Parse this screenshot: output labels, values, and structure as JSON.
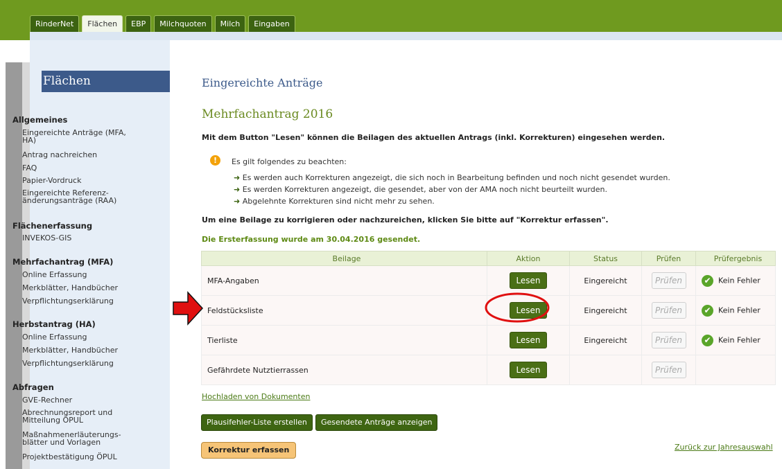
{
  "tabs": [
    "RinderNet",
    "Flächen",
    "EBP",
    "Milchquoten",
    "Milch",
    "Eingaben"
  ],
  "active_tab": "Flächen",
  "sidebar": {
    "title": "Flächen",
    "sections": [
      {
        "heading": "Allgemeines",
        "items": [
          "Eingereichte Anträge (MFA,\nHA)",
          "Antrag nachreichen",
          "FAQ",
          "Papier-Vordruck",
          "Eingereichte Referenz-\nänderungsanträge (RAA)"
        ]
      },
      {
        "heading": "Flächenerfassung",
        "items": [
          "INVEKOS-GIS"
        ]
      },
      {
        "heading": "Mehrfachantrag (MFA)",
        "items": [
          "Online Erfassung",
          "Merkblätter, Handbücher",
          "Verpflichtungserklärung"
        ]
      },
      {
        "heading": "Herbstantrag (HA)",
        "items": [
          "Online Erfassung",
          "Merkblätter, Handbücher",
          "Verpflichtungserklärung"
        ]
      },
      {
        "heading": "Abfragen",
        "items": [
          "GVE-Rechner",
          "Abrechnungsreport und\nMitteilung ÖPUL",
          "Maßnahmenerläuterungs-\nblätter und Vorlagen",
          "Projektbestätigung ÖPUL"
        ]
      }
    ]
  },
  "main": {
    "title": "Eingereichte Anträge",
    "subtitle": "Mehrfachantrag 2016",
    "intro": "Mit dem Button \"Lesen\" können die Beilagen des aktuellen Antrags (inkl. Korrekturen) eingesehen werden.",
    "note_heading": "Es gilt folgendes zu beachten:",
    "notes": [
      "Es werden auch Korrekturen angezeigt, die sich noch in Bearbeitung befinden und noch nicht gesendet wurden.",
      "Es werden Korrekturen angezeigt, die gesendet, aber von der AMA noch nicht beurteilt wurden.",
      "Abgelehnte Korrekturen sind nicht mehr zu sehen."
    ],
    "correction_hint": "Um eine Beilage zu korrigieren oder nachzureichen, klicken Sie bitte auf \"Korrektur erfassen\".",
    "sent_info": "Die Ersterfassung wurde am 30.04.2016 gesendet.",
    "table": {
      "headers": [
        "Beilage",
        "Aktion",
        "Status",
        "Prüfen",
        "Prüfergebnis"
      ],
      "rows": [
        {
          "beilage": "MFA-Angaben",
          "aktion": "Lesen",
          "status": "Eingereicht",
          "pruefen": "Prüfen",
          "ergebnis": "Kein Fehler"
        },
        {
          "beilage": "Feldstücksliste",
          "aktion": "Lesen",
          "status": "Eingereicht",
          "pruefen": "Prüfen",
          "ergebnis": "Kein Fehler"
        },
        {
          "beilage": "Tierliste",
          "aktion": "Lesen",
          "status": "Eingereicht",
          "pruefen": "Prüfen",
          "ergebnis": "Kein Fehler"
        },
        {
          "beilage": "Gefährdete Nutztierrassen",
          "aktion": "Lesen",
          "status": "",
          "pruefen": "Prüfen",
          "ergebnis": ""
        }
      ]
    },
    "upload_link": "Hochladen von Dokumenten",
    "buttons": {
      "plausi": "Plausifehler-Liste erstellen",
      "gesendete": "Gesendete Anträge anzeigen",
      "korrektur": "Korrektur erfassen"
    },
    "back_link": "Zurück zur Jahresauswahl"
  },
  "colors": {
    "header_green": "#6f9a1f",
    "sidebar_bg": "#e6eef7",
    "sidebar_title": "#3c5a8a",
    "button_green": "#4a6f16",
    "annotation_red": "#e01010"
  }
}
